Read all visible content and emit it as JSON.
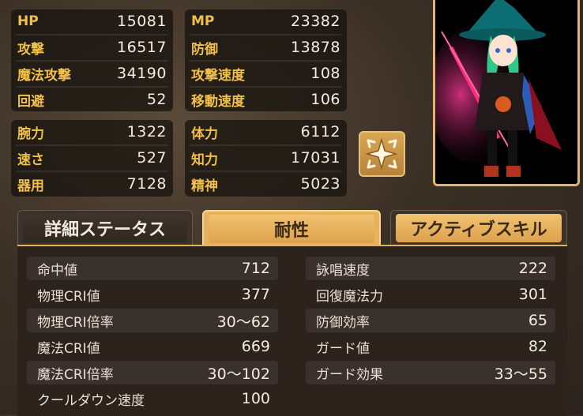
{
  "stats_top": [
    {
      "label": "HP",
      "value": "15081"
    },
    {
      "label": "攻撃",
      "value": "16517"
    },
    {
      "label": "魔法攻撃",
      "value": "34190"
    },
    {
      "label": "回避",
      "value": "52"
    }
  ],
  "stats_top_right": [
    {
      "label": "MP",
      "value": "23382"
    },
    {
      "label": "防御",
      "value": "13878"
    },
    {
      "label": "攻撃速度",
      "value": "108"
    },
    {
      "label": "移動速度",
      "value": "106"
    }
  ],
  "stats_bottom": [
    {
      "label": "腕力",
      "value": "1322"
    },
    {
      "label": "速さ",
      "value": "527"
    },
    {
      "label": "器用",
      "value": "7128"
    }
  ],
  "stats_bottom_right": [
    {
      "label": "体力",
      "value": "6112"
    },
    {
      "label": "知力",
      "value": "17031"
    },
    {
      "label": "精神",
      "value": "5023"
    }
  ],
  "tabs": [
    {
      "label": "詳細ステータス",
      "active": false
    },
    {
      "label": "耐性",
      "active": true
    },
    {
      "label": "アクティブスキル",
      "active": false
    }
  ],
  "detail_left": [
    {
      "label": "命中値",
      "value": "712"
    },
    {
      "label": "物理CRI値",
      "value": "377"
    },
    {
      "label": "物理CRI倍率",
      "value": "30～62"
    },
    {
      "label": "魔法CRI値",
      "value": "669"
    },
    {
      "label": "魔法CRI倍率",
      "value": "30～102"
    },
    {
      "label": "クールダウン速度",
      "value": "100"
    }
  ],
  "detail_right": [
    {
      "label": "詠唱速度",
      "value": "222"
    },
    {
      "label": "回復魔法力",
      "value": "301"
    },
    {
      "label": "防御効率",
      "value": "65"
    },
    {
      "label": "ガード値",
      "value": "82"
    },
    {
      "label": "ガード効果",
      "value": "33～55"
    }
  ],
  "skill_button_icon": "sparkle-skill-icon",
  "colors": {
    "label_gold": "#f0c04a",
    "tab_active": "#e8b25c",
    "frame_gold": "#e3b56a",
    "hair": "#2fc88a"
  }
}
